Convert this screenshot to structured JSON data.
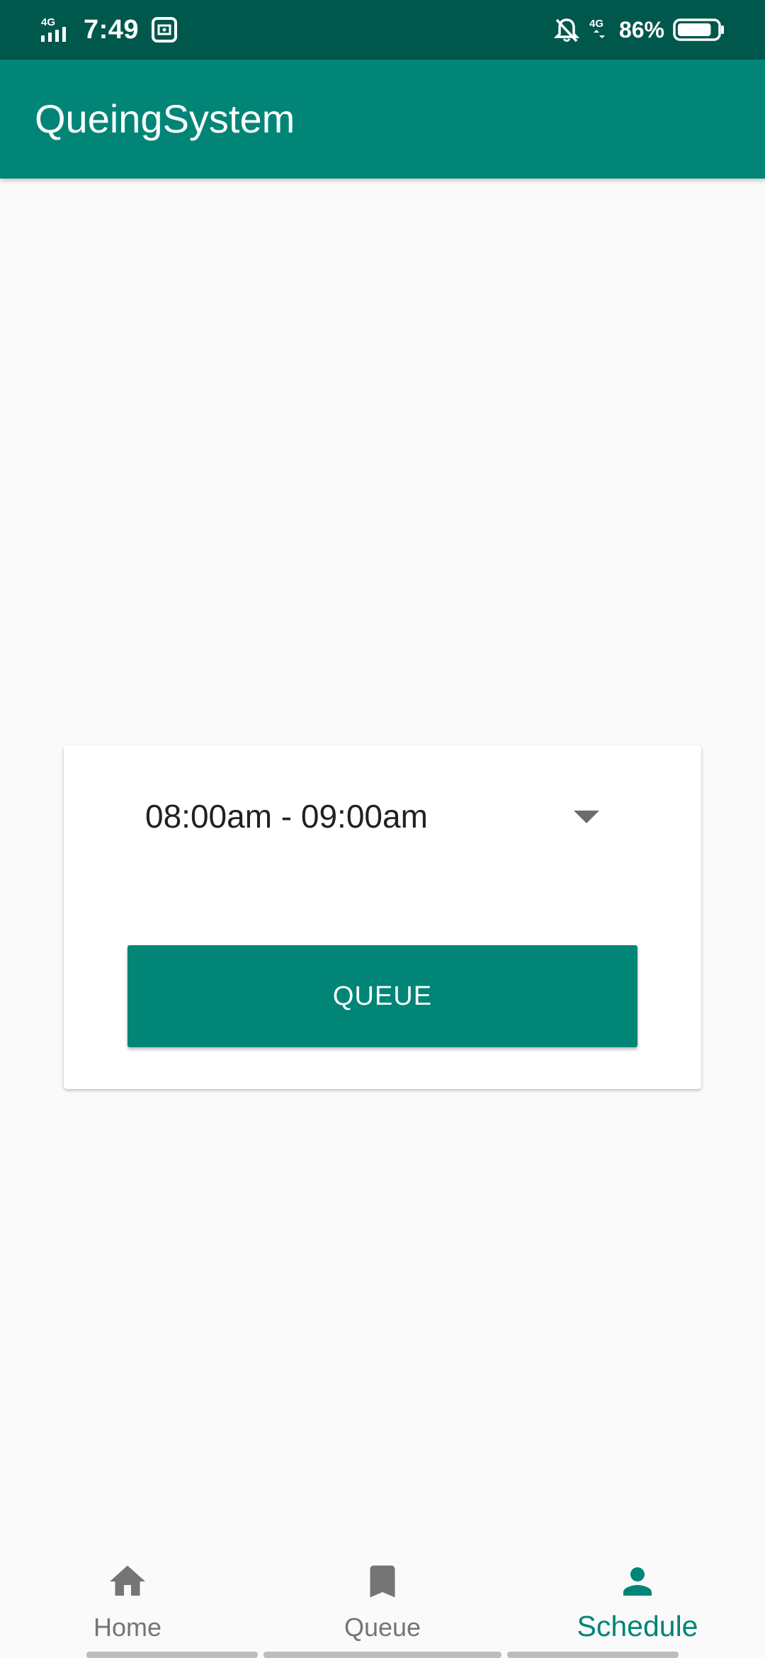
{
  "status_bar": {
    "network_type": "4G",
    "time": "7:49",
    "network_type_right": "4G",
    "battery_percent": "86%",
    "battery_level": 0.86,
    "icons": [
      "signal-icon",
      "notification-app-icon",
      "bell-off-icon",
      "data-arrows-icon",
      "battery-icon"
    ]
  },
  "app_bar": {
    "title": "QueingSystem"
  },
  "schedule_card": {
    "selected_time_slot": "08:00am - 09:00am",
    "queue_button_label": "QUEUE"
  },
  "bottom_nav": {
    "active": "Schedule",
    "items": [
      {
        "label": "Home",
        "icon": "home-icon"
      },
      {
        "label": "Queue",
        "icon": "bookmark-icon"
      },
      {
        "label": "Schedule",
        "icon": "person-icon"
      }
    ]
  },
  "colors": {
    "status_bar": "#00574b",
    "primary": "#008577",
    "inactive_nav": "#757575",
    "background": "#fafafa"
  }
}
